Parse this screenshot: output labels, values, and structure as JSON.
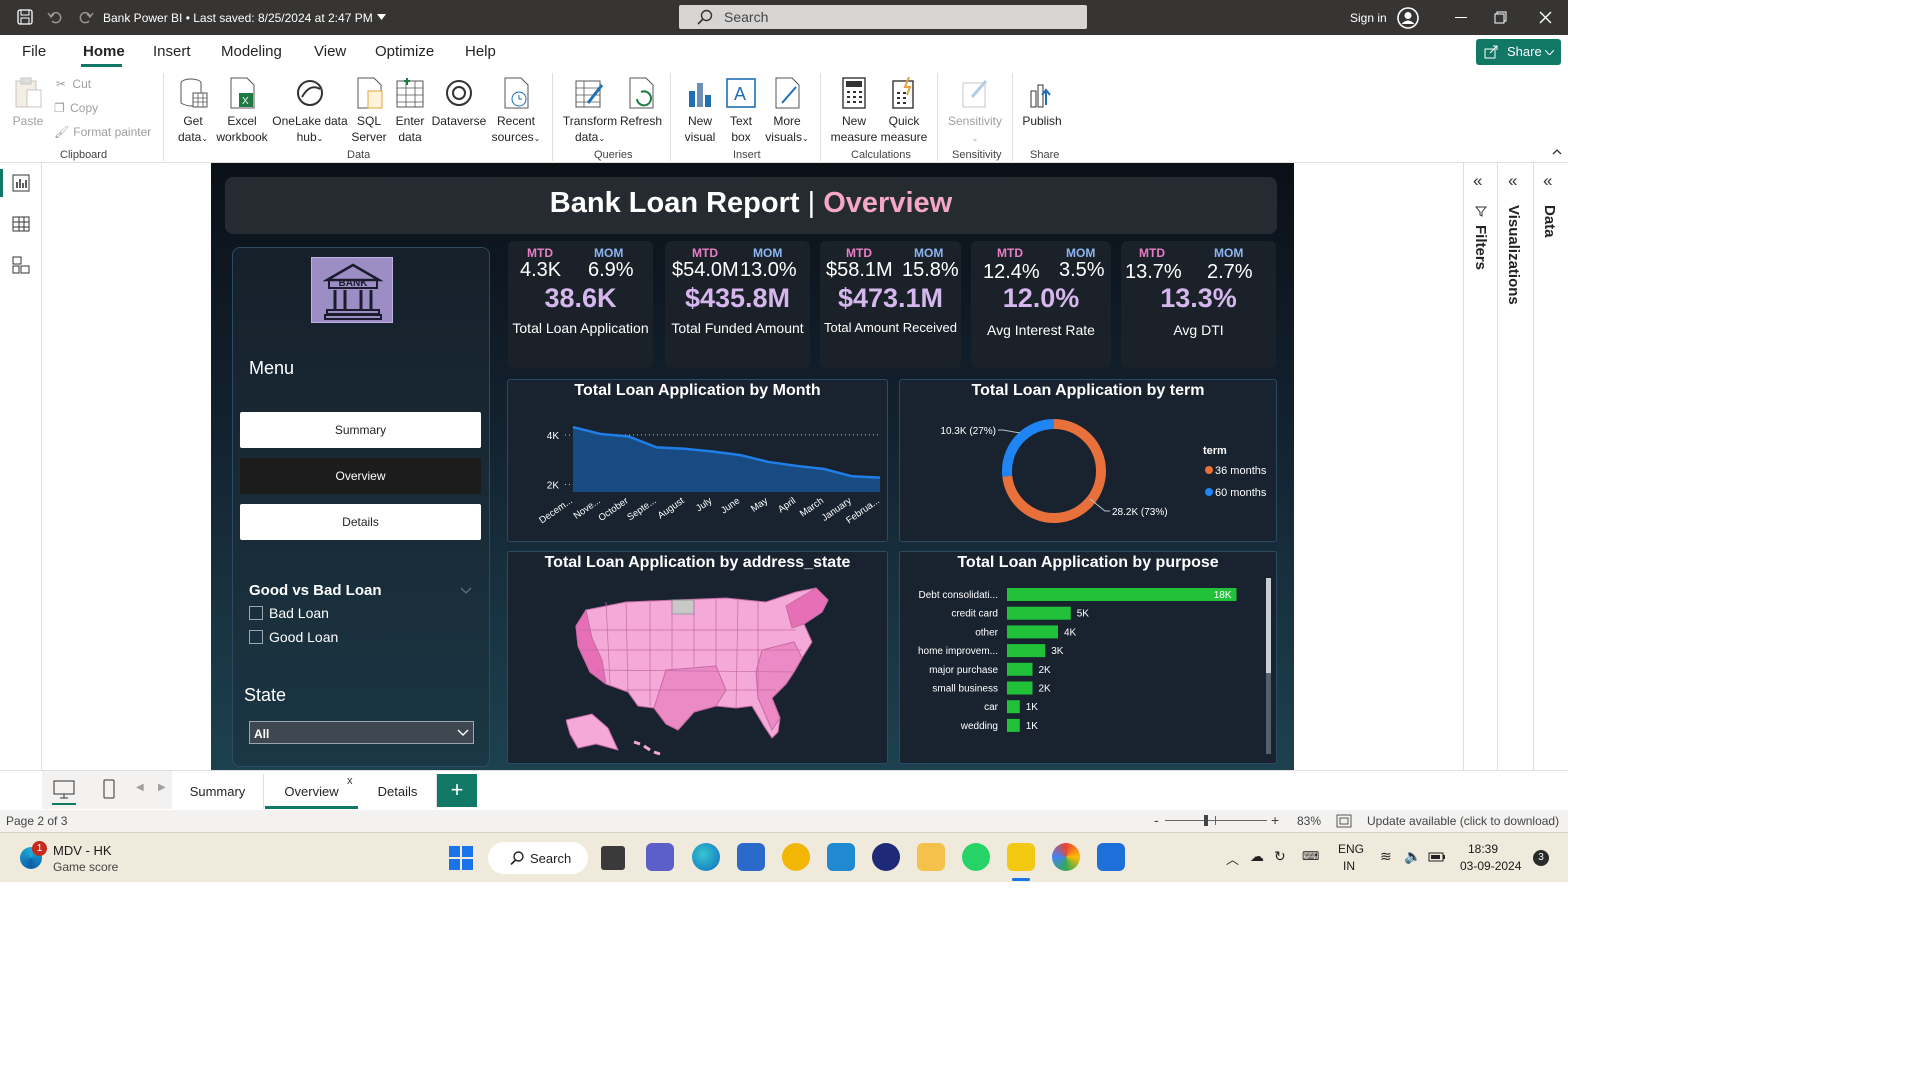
{
  "titlebar": {
    "title": "Bank Power BI • Last saved: 8/25/2024 at 2:47 PM",
    "search_placeholder": "Search",
    "sign_in": "Sign in"
  },
  "menu": {
    "items": [
      "File",
      "Home",
      "Insert",
      "Modeling",
      "View",
      "Optimize",
      "Help"
    ],
    "active": "Home",
    "share": "Share"
  },
  "ribbon": {
    "paste": "Paste",
    "cut": "Cut",
    "copy": "Copy",
    "format_painter": "Format painter",
    "groups": {
      "clipboard": "Clipboard",
      "data": "Data",
      "queries": "Queries",
      "insert": "Insert",
      "calculations": "Calculations",
      "sensitivity": "Sensitivity",
      "share": "Share"
    },
    "get_data": [
      "Get",
      "data"
    ],
    "excel": [
      "Excel",
      "workbook"
    ],
    "onelake": [
      "OneLake data",
      "hub"
    ],
    "sql": [
      "SQL",
      "Server"
    ],
    "enter": [
      "Enter",
      "data"
    ],
    "dataverse": "Dataverse",
    "recent": [
      "Recent",
      "sources"
    ],
    "transform": [
      "Transform",
      "data"
    ],
    "refresh": "Refresh",
    "new_visual": [
      "New",
      "visual"
    ],
    "text_box": [
      "Text",
      "box"
    ],
    "more_visuals": [
      "More",
      "visuals"
    ],
    "new_measure": [
      "New",
      "measure"
    ],
    "quick_measure": [
      "Quick",
      "measure"
    ],
    "sensitivity": "Sensitivity",
    "publish": "Publish"
  },
  "report": {
    "title_main": "Bank Loan Report",
    "title_sep": "|",
    "title_accent": "Overview",
    "logo_text": "BANK",
    "menu_heading": "Menu",
    "nav": [
      "Summary",
      "Overview",
      "Details"
    ],
    "good_bad": {
      "heading": "Good vs Bad Loan",
      "options": [
        "Bad Loan",
        "Good Loan"
      ]
    },
    "state": {
      "heading": "State",
      "value": "All"
    },
    "kpis": [
      {
        "mtd_label": "MTD",
        "mom_label": "MOM",
        "mtd": "4.3K",
        "mom": "6.9%",
        "value": "38.6K",
        "label": "Total Loan Application"
      },
      {
        "mtd_label": "MTD",
        "mom_label": "MOM",
        "mtd": "$54.0M",
        "mom": "13.0%",
        "value": "$435.8M",
        "label": "Total Funded Amount"
      },
      {
        "mtd_label": "MTD",
        "mom_label": "MOM",
        "mtd": "$58.1M",
        "mom": "15.8%",
        "value": "$473.1M",
        "label": "Total Amount Received"
      },
      {
        "mtd_label": "MTD",
        "mom_label": "MOM",
        "mtd": "12.4%",
        "mom": "3.5%",
        "value": "12.0%",
        "label": "Avg Interest Rate"
      },
      {
        "mtd_label": "MTD",
        "mom_label": "MOM",
        "mtd": "13.7%",
        "mom": "2.7%",
        "value": "13.3%",
        "label": "Avg DTI"
      }
    ],
    "charts": {
      "month_title": "Total Loan Application by Month",
      "term_title": "Total Loan Application by term",
      "state_title": "Total Loan Application by address_state",
      "purpose_title": "Total Loan Application by purpose"
    }
  },
  "chart_data": [
    {
      "type": "area",
      "title": "Total Loan Application by Month",
      "categories": [
        "Decem...",
        "Nove...",
        "October",
        "Septe...",
        "August",
        "July",
        "June",
        "May",
        "April",
        "March",
        "January",
        "Februa..."
      ],
      "values": [
        4314,
        4035,
        3934,
        3498,
        3441,
        3331,
        3184,
        2911,
        2755,
        2627,
        2332,
        2279
      ],
      "yticks": [
        "4K",
        "2K"
      ],
      "ylim": [
        1700,
        4600
      ],
      "color": "#1f7ee8"
    },
    {
      "type": "pie",
      "title": "Total Loan Application by term",
      "legend_title": "term",
      "series": [
        {
          "name": "36 months",
          "value": 28200,
          "label": "28.2K (73%)",
          "color": "#e8703a"
        },
        {
          "name": "60 months",
          "value": 10300,
          "label": "10.3K (27%)",
          "color": "#1f85f5"
        }
      ]
    },
    {
      "type": "bar",
      "title": "Total Loan Application by purpose",
      "categories": [
        "Debt consolidati...",
        "credit card",
        "other",
        "home improvem...",
        "major purchase",
        "small business",
        "car",
        "wedding"
      ],
      "values": [
        18000,
        5000,
        4000,
        3000,
        2000,
        2000,
        1000,
        1000
      ],
      "labels": [
        "18K",
        "5K",
        "4K",
        "3K",
        "2K",
        "2K",
        "1K",
        "1K"
      ],
      "xlim": [
        0,
        20000
      ],
      "color": "#21c13a"
    }
  ],
  "panes": {
    "filters": "Filters",
    "visualizations": "Visualizations",
    "data": "Data"
  },
  "tabs": {
    "items": [
      "Summary",
      "Overview",
      "Details"
    ],
    "active": "Overview",
    "close": "x",
    "add": "+"
  },
  "status": {
    "page": "Page 2 of 3",
    "zoom": "83%",
    "update": "Update available (click to download)",
    "minus": "-",
    "plus": "+"
  },
  "taskbar": {
    "game_name": "MDV - HK",
    "game_sub": "Game score",
    "game_badge": "1",
    "search": "Search",
    "lang1": "ENG",
    "lang2": "IN",
    "time": "18:39",
    "date": "03-09-2024",
    "notif": "3"
  }
}
